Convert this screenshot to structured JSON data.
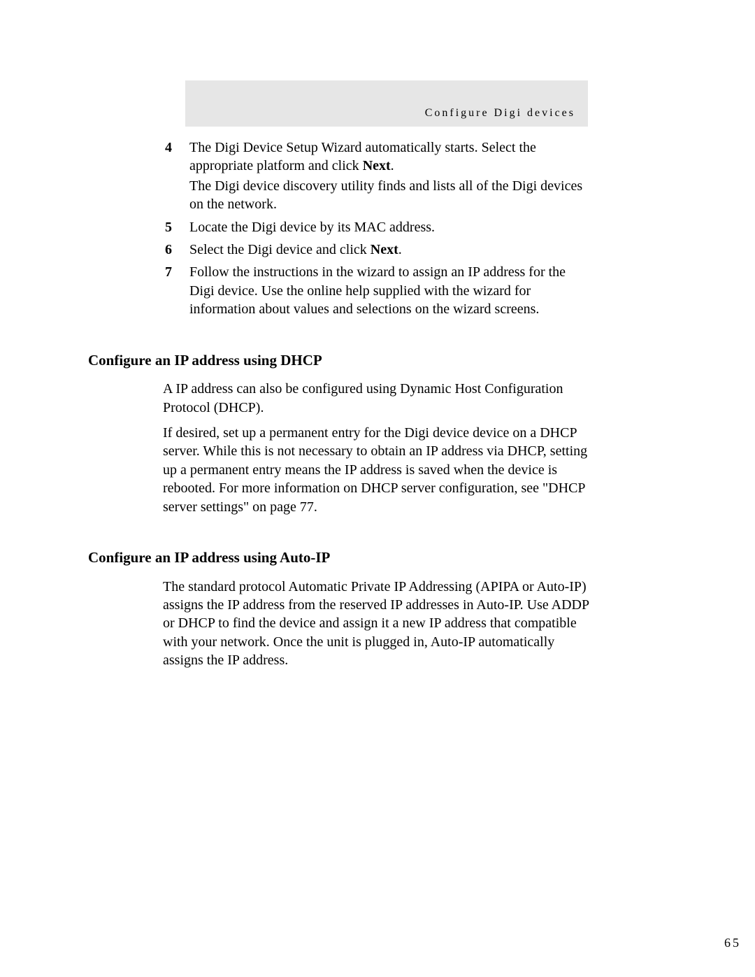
{
  "header": {
    "title": "Configure Digi devices"
  },
  "steps": [
    {
      "num": "4",
      "paras": [
        {
          "pre": "The Digi Device Setup Wizard automatically starts. Select the appropriate platform and click ",
          "bold": "Next",
          "post": "."
        },
        {
          "pre": "The Digi device discovery utility finds and lists all of the Digi devices on the network.",
          "bold": "",
          "post": ""
        }
      ]
    },
    {
      "num": "5",
      "paras": [
        {
          "pre": "Locate the Digi device by its MAC address.",
          "bold": "",
          "post": ""
        }
      ]
    },
    {
      "num": "6",
      "paras": [
        {
          "pre": "Select the Digi device and click ",
          "bold": "Next",
          "post": "."
        }
      ]
    },
    {
      "num": "7",
      "paras": [
        {
          "pre": "Follow the instructions in the wizard to assign an IP address for the Digi device. Use the online help supplied with the wizard for information about values and selections on the wizard screens.",
          "bold": "",
          "post": ""
        }
      ]
    }
  ],
  "section1": {
    "heading": "Configure an IP address using DHCP",
    "paras": [
      "A IP address can also be configured using Dynamic Host Configuration Protocol (DHCP).",
      "If desired, set up a permanent entry for the Digi device device on a DHCP server. While this is not necessary to obtain an IP address via DHCP, setting up a permanent entry means the IP address is saved when the device is rebooted. For more information on DHCP server configuration, see \"DHCP server settings\" on page 77."
    ]
  },
  "section2": {
    "heading": "Configure an IP address using Auto-IP",
    "paras": [
      "The standard protocol Automatic Private IP Addressing (APIPA or Auto-IP) assigns the IP address from the reserved IP addresses in Auto-IP. Use ADDP or DHCP to find the device and assign it a new IP address that compatible with your network. Once the unit is plugged in, Auto-IP automatically assigns the IP address."
    ]
  },
  "page_number": "65"
}
